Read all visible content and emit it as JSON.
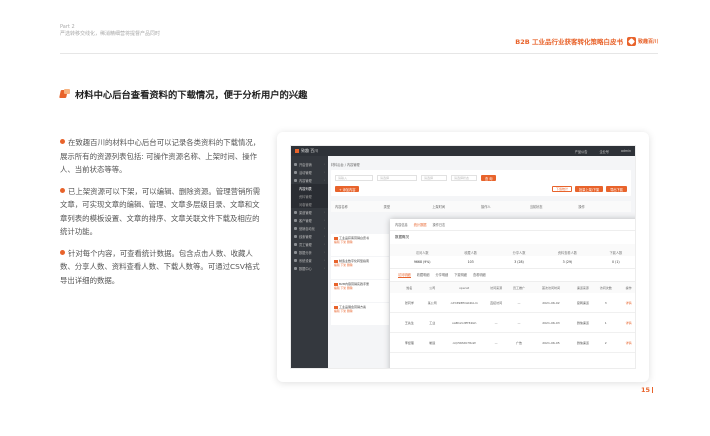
{
  "header": {
    "part": "Part 2",
    "part_subtitle": "严选转移交线化，稀消精细营将提督产品同时",
    "brand_text": "B2B 工业品行业获客转化策略白皮书",
    "logo_text": "致趣百川"
  },
  "heading": "材料中心后台查看资料的下载情况，便于分析用户的兴趣",
  "bullets": [
    "在致趣百川的材料中心后台可以记录各类资料的下载情况，展示所有的资源列表包括: 可操作资源名称、上架时间、操作人、当前状态等等。",
    "已上架资源可以下架，可以编辑、删除资源。管理营销所需文章，可实现文章的编辑、管理、文章多层级目录、文章和文章列表的模板设置、文章的排序、文章关联文件下载及相应的统计功能。",
    "针对每个内容，可查看统计数据。包含点击人数、收藏人数、分享人数、资料查看人数、下载人数等。可通过CSV格式导出详细的数据。"
  ],
  "screenshot": {
    "app_name": "致趣 百川",
    "topbar": [
      "产品公告",
      "企业号",
      "admin"
    ],
    "sidebar": [
      {
        "label": "开启营销",
        "sub": false,
        "active": false
      },
      {
        "label": "活动管理",
        "sub": false,
        "active": false
      },
      {
        "label": "内容管理",
        "sub": false,
        "active": false
      },
      {
        "label": "内容列表",
        "sub": true,
        "active": true
      },
      {
        "label": "资料管理",
        "sub": true,
        "active": false
      },
      {
        "label": "问卷管理",
        "sub": true,
        "active": false
      },
      {
        "label": "渠道管理",
        "sub": false,
        "active": false
      },
      {
        "label": "客户管理",
        "sub": false,
        "active": false
      },
      {
        "label": "营销自动化",
        "sub": false,
        "active": false
      },
      {
        "label": "线索管理",
        "sub": false,
        "active": false
      },
      {
        "label": "员工管理",
        "sub": false,
        "active": false
      },
      {
        "label": "数据分析",
        "sub": false,
        "active": false
      },
      {
        "label": "系统设置",
        "sub": false,
        "active": false
      },
      {
        "label": "数据中心",
        "sub": false,
        "active": false
      }
    ],
    "breadcrumb": "材料后台 / 内容管理",
    "filters": [
      "请输入",
      "请选择",
      "请选择",
      "请选择状态"
    ],
    "search_btn": "查 询",
    "add_btn": "+ 添加内容",
    "action_btns": [
      "下载统计",
      "批量上架/下架",
      "导出下载"
    ],
    "table_headers": [
      "内容名称",
      "类型",
      "上架时间",
      "操作人",
      "当前状态",
      "操作"
    ],
    "rows": [
      {
        "title": "工业品获客营销白皮书",
        "actions": "编辑 下架 删除"
      },
      {
        "title": "制造业数字化转型指南",
        "actions": "编辑 下架 删除"
      },
      {
        "title": "B2B内容营销实践手册",
        "actions": "编辑 下架 删除"
      },
      {
        "title": "工业品展会营销方案",
        "actions": "编辑 下架 删除"
      }
    ],
    "modal": {
      "tabs": [
        "内容信息",
        "统计数据",
        "操作日志"
      ],
      "title": "数据概况",
      "close": "关闭",
      "stats_headers": [
        "访问人数",
        "收藏人数",
        "分享人数",
        "资料查看人数",
        "下载人数"
      ],
      "stats_values": [
        "9668 (9%)",
        "103",
        "3 (28)",
        "3 (29)",
        "0 (1)"
      ],
      "stat_tabs": [
        "访问明细",
        "收藏明细",
        "分享明细",
        "下载明细",
        "查看明细"
      ],
      "table_headers": [
        "姓名",
        "公司",
        "openid",
        "访问来源",
        "员工推广",
        "首次访问时间",
        "渠道来源",
        "访问次数",
        "操作"
      ],
      "table_rows": [
        [
          "张同学",
          "某公司",
          "oXYZ98fhGK2kLm",
          "直接访问",
          "—",
          "2021-06-02",
          "官网渠道",
          "3",
          "详情"
        ],
        [
          "王先生",
          "工业",
          "oAB12cdEf34Gh",
          "—",
          "—",
          "2021-06-03",
          "微信渠道",
          "1",
          "详情"
        ],
        [
          "李经理",
          "制造",
          "oQr56StU78vW",
          "—",
          "广告",
          "2021-06-05",
          "微信渠道",
          "2",
          "详情"
        ]
      ]
    }
  },
  "page_number": "15"
}
